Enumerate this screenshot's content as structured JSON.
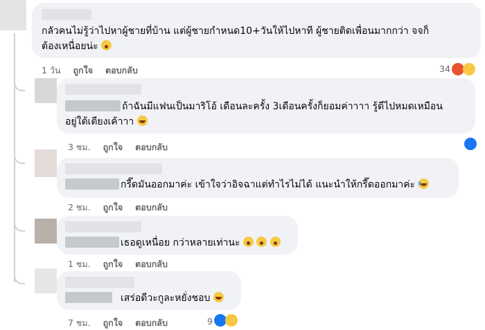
{
  "comments": [
    {
      "text_lines": [
        "กลัวคนไม่รู้ว่าไปหาผู้ชายที่บ้าน แต่ผู้ชายกำหนด10+วันให้ไปหาที ผู้ชายติดเพื่อนมากกว่า จจก็",
        "ต้องเหนื่อยน่ะ"
      ],
      "emoji": "wow",
      "time": "1 วัน",
      "like_label": "ถูกใจ",
      "reply_label": "ตอบกลับ",
      "reaction_count": "34"
    },
    {
      "text_lines": [
        "ถ้าฉันมีแฟนเป็นมาริโอ้ เดือนละครั้ง 3เดือนครั้งก็ยอมค่าาาา รู้ดีไปหมดเหมือน",
        "อยู่ใต้เตียงเค้าาา"
      ],
      "emoji": "laugh",
      "time": "3 ชม.",
      "like_label": "ถูกใจ",
      "reply_label": "ตอบกลับ"
    },
    {
      "text_lines": [
        "กรี๊ดมันออกมาค่ะ เข้าใจว่าอิจฉาแต่ทำไรไม่ได้ แนะนำให้กรี๊ดออกมาค่ะ"
      ],
      "emoji": "tear",
      "time": "2 ชม.",
      "like_label": "ถูกใจ",
      "reply_label": "ตอบกลับ"
    },
    {
      "text_lines": [
        "เธอดูเหนื่อย กว่าหลายเท่านะ"
      ],
      "emoji": "wow",
      "time": "1 ชม.",
      "like_label": "ถูกใจ",
      "reply_label": "ตอบกลับ"
    },
    {
      "text_lines": [
        "เสร่อดีวะกูละหยั่งชอบ"
      ],
      "emoji": "laugh",
      "time": "7 ชม.",
      "like_label": "ถูกใจ",
      "reply_label": "ตอบกลับ",
      "reaction_count": "9"
    }
  ],
  "colors": {
    "bubble": "#f0f2f5",
    "meta_text": "#65676b",
    "like_blue": "#1877f2"
  },
  "icons": [
    "like-reaction-icon",
    "haha-reaction-icon",
    "angry-reaction-icon"
  ]
}
